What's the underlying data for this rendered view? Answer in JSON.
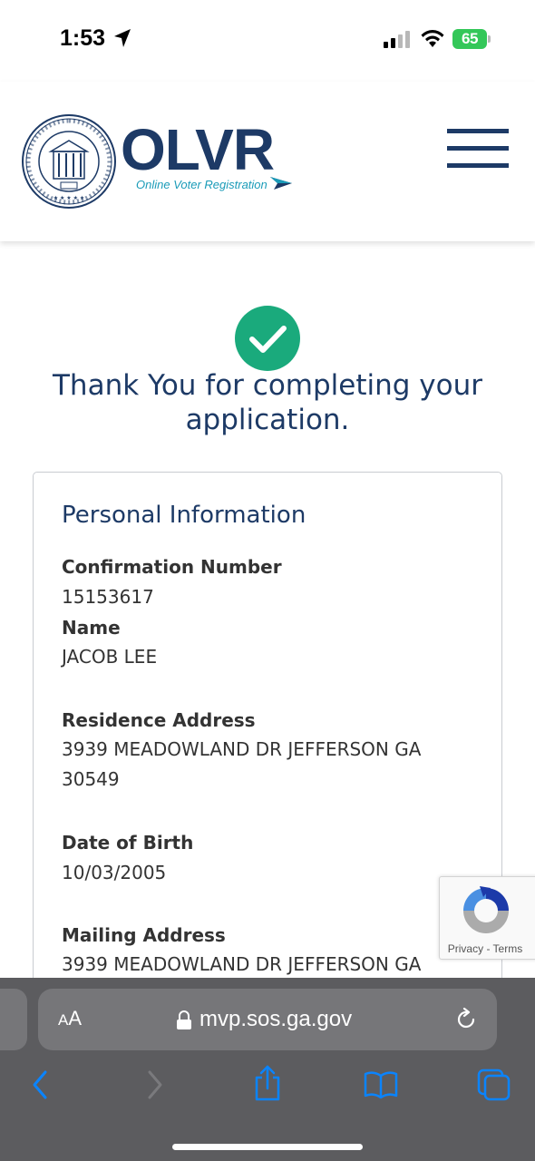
{
  "status_bar": {
    "time": "1:53",
    "battery": "65",
    "icons": [
      "location-arrow-icon",
      "cellular-signal-icon",
      "wifi-icon",
      "battery-icon"
    ]
  },
  "header": {
    "logo_text": "OLVR",
    "tagline": "Online Voter Registration",
    "seal_text": "SECRETARY OF STATE BRAD RAFFENSPERGER",
    "seal_inner": "STATE OF GEORGIA",
    "seal_year": "1776",
    "menu_icon": "hamburger-menu-icon"
  },
  "main": {
    "success_icon": "checkmark-circle-icon",
    "heading": "Thank You for completing your application.",
    "card": {
      "title": "Personal Information",
      "fields": [
        {
          "label": "Confirmation Number",
          "value": "15153617"
        },
        {
          "label": "Name",
          "value": "JACOB LEE"
        },
        {
          "label": "Residence Address",
          "value": "3939 MEADOWLAND DR JEFFERSON GA 30549"
        },
        {
          "label": "Date of Birth",
          "value": "10/03/2005"
        },
        {
          "label": "Mailing Address",
          "value": "3939 MEADOWLAND DR JEFFERSON GA"
        }
      ]
    }
  },
  "recaptcha": {
    "links": "Privacy - Terms"
  },
  "browser": {
    "aa_label_small": "A",
    "aa_label_large": "A",
    "url": "mvp.sos.ga.gov",
    "toolbar": [
      "back-icon",
      "forward-icon",
      "share-icon",
      "bookmarks-icon",
      "tabs-icon"
    ],
    "colors": {
      "bar": "#5c5c5f",
      "pill": "#767679",
      "accent": "#0a84ff"
    }
  },
  "colors": {
    "brand_navy": "#1d3a66",
    "success_green": "#1aaa7c",
    "tagline_teal": "#1a9bb8"
  }
}
